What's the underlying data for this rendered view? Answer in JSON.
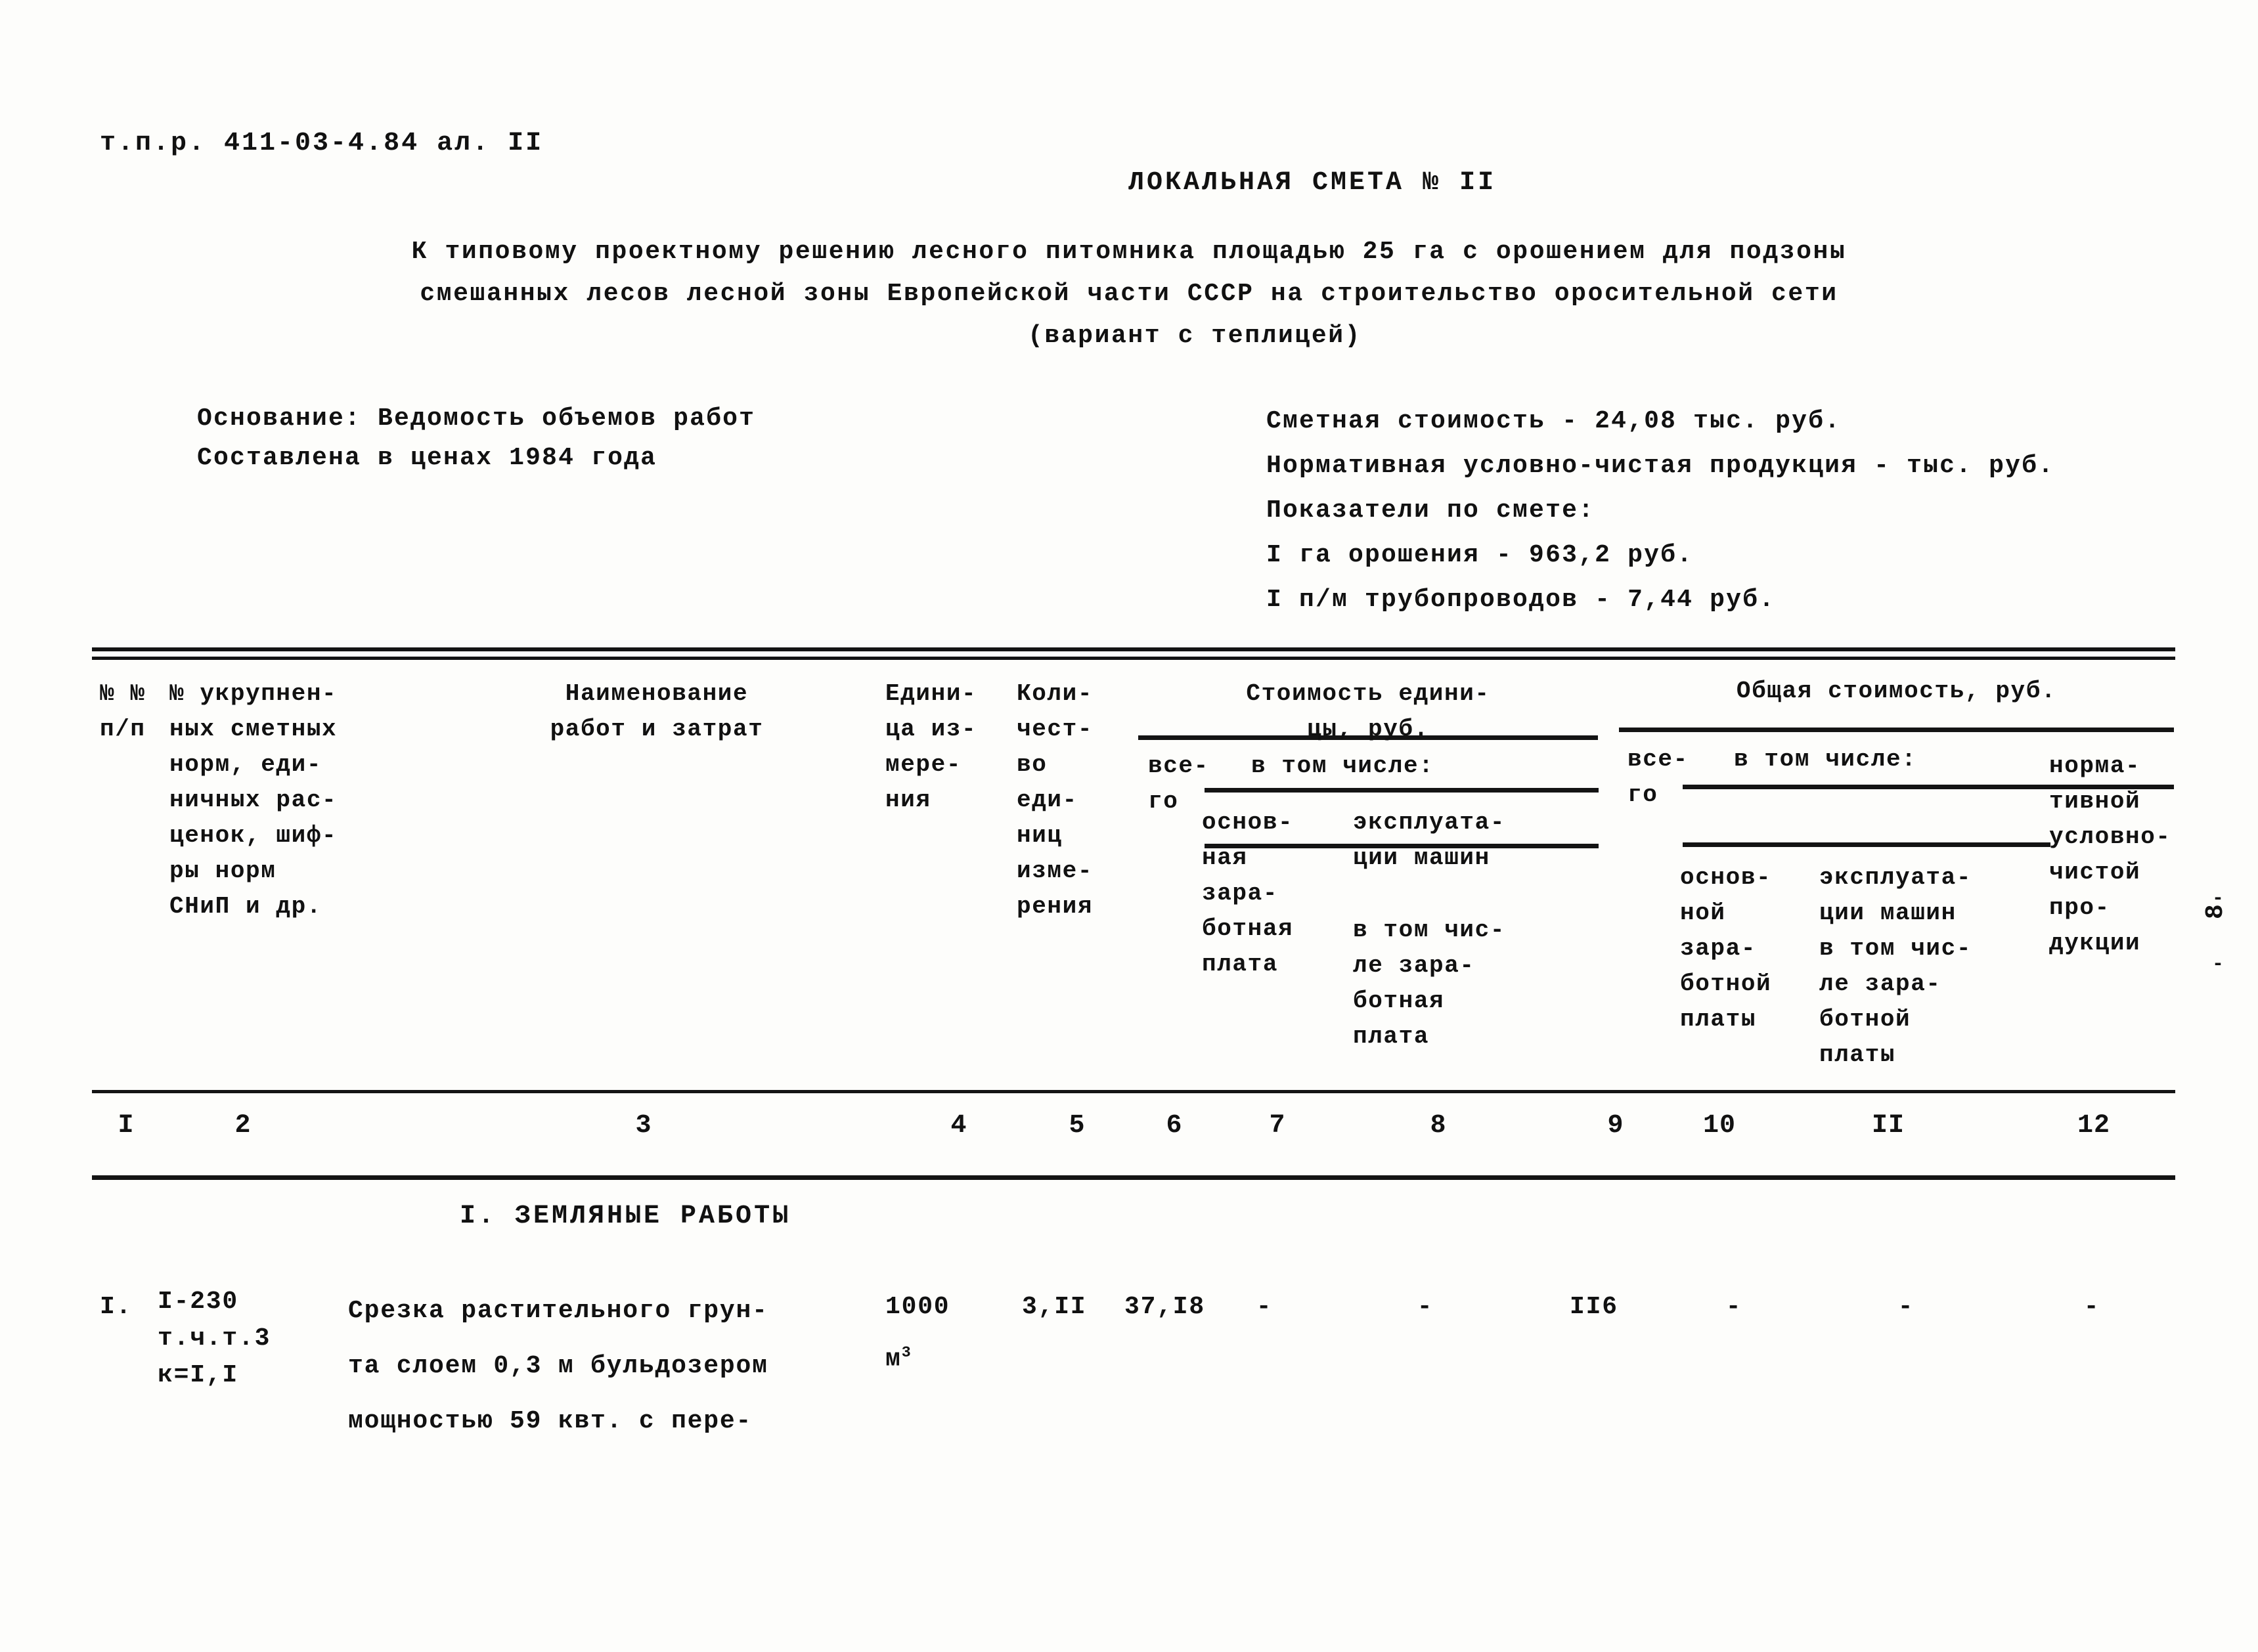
{
  "document": {
    "code": "т.п.р. 411-03-4.84 ал. II",
    "title": "ЛОКАЛЬНАЯ СМЕТА № II",
    "subtitle_line1": "К типовому проектному решению лесного питомника площадью 25 га с орошением для подзоны",
    "subtitle_line2": "смешанных лесов лесной зоны Европейской части СССР на строительство оросительной сети",
    "subtitle_line3": "(вариант с теплицей)",
    "page_number": "8"
  },
  "basis": {
    "line1": "Основание: Ведомость объемов работ",
    "line2": "Составлена в ценах 1984 года"
  },
  "summary": {
    "line1": "Сметная стоимость - 24,08 тыс. руб.",
    "line2": "Нормативная условно-чистая продукция - тыс. руб.",
    "line3": "Показатели по смете:",
    "line4": "I га орошения - 963,2 руб.",
    "line5": "I п/м трубопроводов - 7,44 руб."
  },
  "table": {
    "headers": {
      "col1": "№ №\nп/п",
      "col2": "№ укрупнен-\nных сметных\nнорм, еди-\nничных рас-\nценок, шиф-\nры норм\nСНиП и др.",
      "col3": "Наименование\nработ и затрат",
      "col4": "Едини-\nца из-\nмере-\nния",
      "col5": "Коли-\nчест-\nво\nеди-\nниц\nизме-\nрения",
      "group_unit_cost": "Стоимость едини-\nцы, руб.",
      "col6": "все-\nго",
      "col_in_which": "в том числе:",
      "col7": "основ-\nная\nзара-\nботная\nплата",
      "col8": "эксплуата-\nции машин",
      "col8b": "в том чис-\nле зара-\nботная\nплата",
      "group_total_cost": "Общая стоимость, руб.",
      "col9": "все-\nго",
      "col_in_which2": "в том числе:",
      "col10": "основ-\nной\nзара-\nботной\nплаты",
      "col11": "эксплуата-\nции машин\nв том чис-\nле зара-\nботной\nплаты",
      "col12": "норма-\nтивной\nусловно-\nчистой\nпро-\nдукции"
    },
    "column_numbers": [
      "I",
      "2",
      "3",
      "4",
      "5",
      "6",
      "7",
      "8",
      "9",
      "10",
      "II",
      "12"
    ],
    "section_heading": "I. ЗЕМЛЯНЫЕ РАБОТЫ",
    "rows": [
      {
        "num": "I.",
        "norm_code": "I-230\nт.ч.т.3\nк=I,I",
        "name": "Срезка растительного грун-\nта слоем 0,3 м бульдозером\nмощностью 59 квт. с пере-",
        "unit_top": "1000",
        "unit_bottom": "м",
        "unit_sup": "3",
        "qty": "3,II",
        "c6": "37,I8",
        "c7": "-",
        "c8": "-",
        "c9": "II6",
        "c10": "-",
        "c11": "-",
        "c12": "-"
      }
    ]
  }
}
